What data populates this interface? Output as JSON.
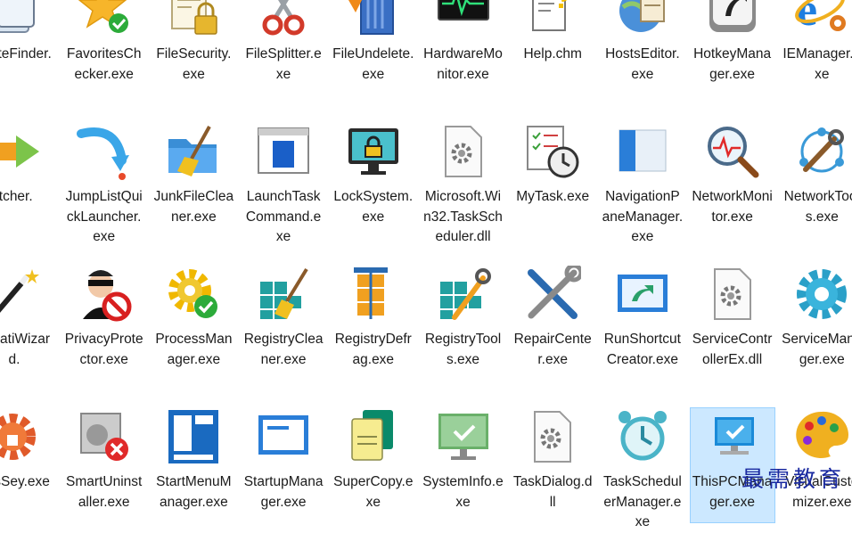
{
  "rows": [
    {
      "items": [
        {
          "label": "licateFinder.",
          "icon": "duplicate-finder-icon"
        },
        {
          "label": "FavoritesChecker.exe",
          "icon": "star-check-icon"
        },
        {
          "label": "FileSecurity.exe",
          "icon": "file-lock-icon"
        },
        {
          "label": "FileSplitter.exe",
          "icon": "scissors-icon"
        },
        {
          "label": "FileUndelete.exe",
          "icon": "undo-arrow-icon"
        },
        {
          "label": "HardwareMonitor.exe",
          "icon": "pulse-monitor-icon"
        },
        {
          "label": "Help.chm",
          "icon": "help-file-icon"
        },
        {
          "label": "HostsEditor.exe",
          "icon": "globe-notepad-icon"
        },
        {
          "label": "HotkeyManager.exe",
          "icon": "keyboard-key-icon"
        },
        {
          "label": "IEManager.exe",
          "icon": "internet-explorer-icon"
        }
      ]
    },
    {
      "items": [
        {
          "label": "itcher.",
          "icon": "switch-arrow-icon"
        },
        {
          "label": "JumpListQuickLauncher.exe",
          "icon": "curved-arrow-icon"
        },
        {
          "label": "JunkFileCleaner.exe",
          "icon": "folder-broom-icon"
        },
        {
          "label": "LaunchTaskCommand.exe",
          "icon": "window-panel-icon"
        },
        {
          "label": "LockSystem.exe",
          "icon": "monitor-lock-icon"
        },
        {
          "label": "Microsoft.Win32.TaskScheduler.dll",
          "icon": "dll-gear-icon"
        },
        {
          "label": "MyTask.exe",
          "icon": "checklist-clock-icon"
        },
        {
          "label": "NavigationPaneManager.exe",
          "icon": "nav-pane-icon"
        },
        {
          "label": "NetworkMonitor.exe",
          "icon": "magnifier-pulse-icon"
        },
        {
          "label": "NetworkTools.exe",
          "icon": "network-wrench-icon"
        }
      ]
    },
    {
      "items": [
        {
          "label": "mizatiWizard.",
          "icon": "magic-wand-icon"
        },
        {
          "label": "PrivacyProtector.exe",
          "icon": "spy-block-icon"
        },
        {
          "label": "ProcessManager.exe",
          "icon": "gear-check-icon"
        },
        {
          "label": "RegistryCleaner.exe",
          "icon": "registry-broom-icon"
        },
        {
          "label": "RegistryDefrag.exe",
          "icon": "registry-clamp-icon"
        },
        {
          "label": "RegistryTools.exe",
          "icon": "registry-wrench-icon"
        },
        {
          "label": "RepairCenter.exe",
          "icon": "wrench-screwdriver-icon"
        },
        {
          "label": "RunShortcutCreator.exe",
          "icon": "shortcut-window-icon"
        },
        {
          "label": "ServiceControllerEx.dll",
          "icon": "dll-gear-icon"
        },
        {
          "label": "ServiceManager.exe",
          "icon": "big-gear-icon"
        }
      ]
    },
    {
      "items": [
        {
          "label": "ngsSey.exe",
          "icon": "gear-lock-icon"
        },
        {
          "label": "SmartUninstaller.exe",
          "icon": "uninstall-box-icon"
        },
        {
          "label": "StartMenuManager.exe",
          "icon": "start-menu-icon"
        },
        {
          "label": "StartupManager.exe",
          "icon": "startup-window-icon"
        },
        {
          "label": "SuperCopy.exe",
          "icon": "copy-docs-icon"
        },
        {
          "label": "SystemInfo.exe",
          "icon": "monitor-check-icon"
        },
        {
          "label": "TaskDialog.dll",
          "icon": "dll-gear-icon"
        },
        {
          "label": "TaskSchedulerManager.exe",
          "icon": "alarm-clock-icon"
        },
        {
          "label": "ThisPCManager.exe",
          "icon": "pc-check-icon",
          "selected": true
        },
        {
          "label": "VisualCustomizer.exe",
          "icon": "palette-icon"
        }
      ]
    }
  ],
  "watermark": "最需教育"
}
